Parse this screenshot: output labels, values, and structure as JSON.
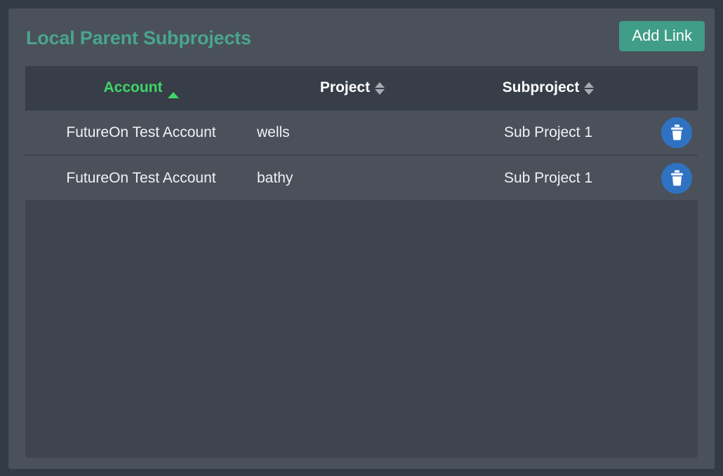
{
  "header": {
    "title": "Local Parent Subprojects",
    "add_link_label": "Add Link"
  },
  "colors": {
    "page_background": "#323a44",
    "card_background": "#4a515a",
    "table_background": "#3e454e",
    "table_header_background": "#373e48",
    "title_text": "#4aa58e",
    "accent_button": "#409d87",
    "active_sort_text": "#3fd668",
    "delete_button": "#2f72c1",
    "row_text": "#f0f2f4"
  },
  "table": {
    "columns": [
      {
        "key": "account",
        "label": "Account",
        "sortable": true,
        "sort_state": "asc",
        "sort_icon": "sort-ascending-icon"
      },
      {
        "key": "project",
        "label": "Project",
        "sortable": true,
        "sort_state": "none",
        "sort_icon": "sort-both-icon"
      },
      {
        "key": "subproject",
        "label": "Subproject",
        "sortable": true,
        "sort_state": "none",
        "sort_icon": "sort-both-icon"
      },
      {
        "key": "actions",
        "label": "",
        "sortable": false,
        "sort_state": "none",
        "sort_icon": ""
      }
    ],
    "rows": [
      {
        "account": "FutureOn Test Account",
        "project": "wells",
        "subproject": "Sub Project 1",
        "action_icon": "trash-icon"
      },
      {
        "account": "FutureOn Test Account",
        "project": "bathy",
        "subproject": "Sub Project 1",
        "action_icon": "trash-icon"
      }
    ]
  }
}
